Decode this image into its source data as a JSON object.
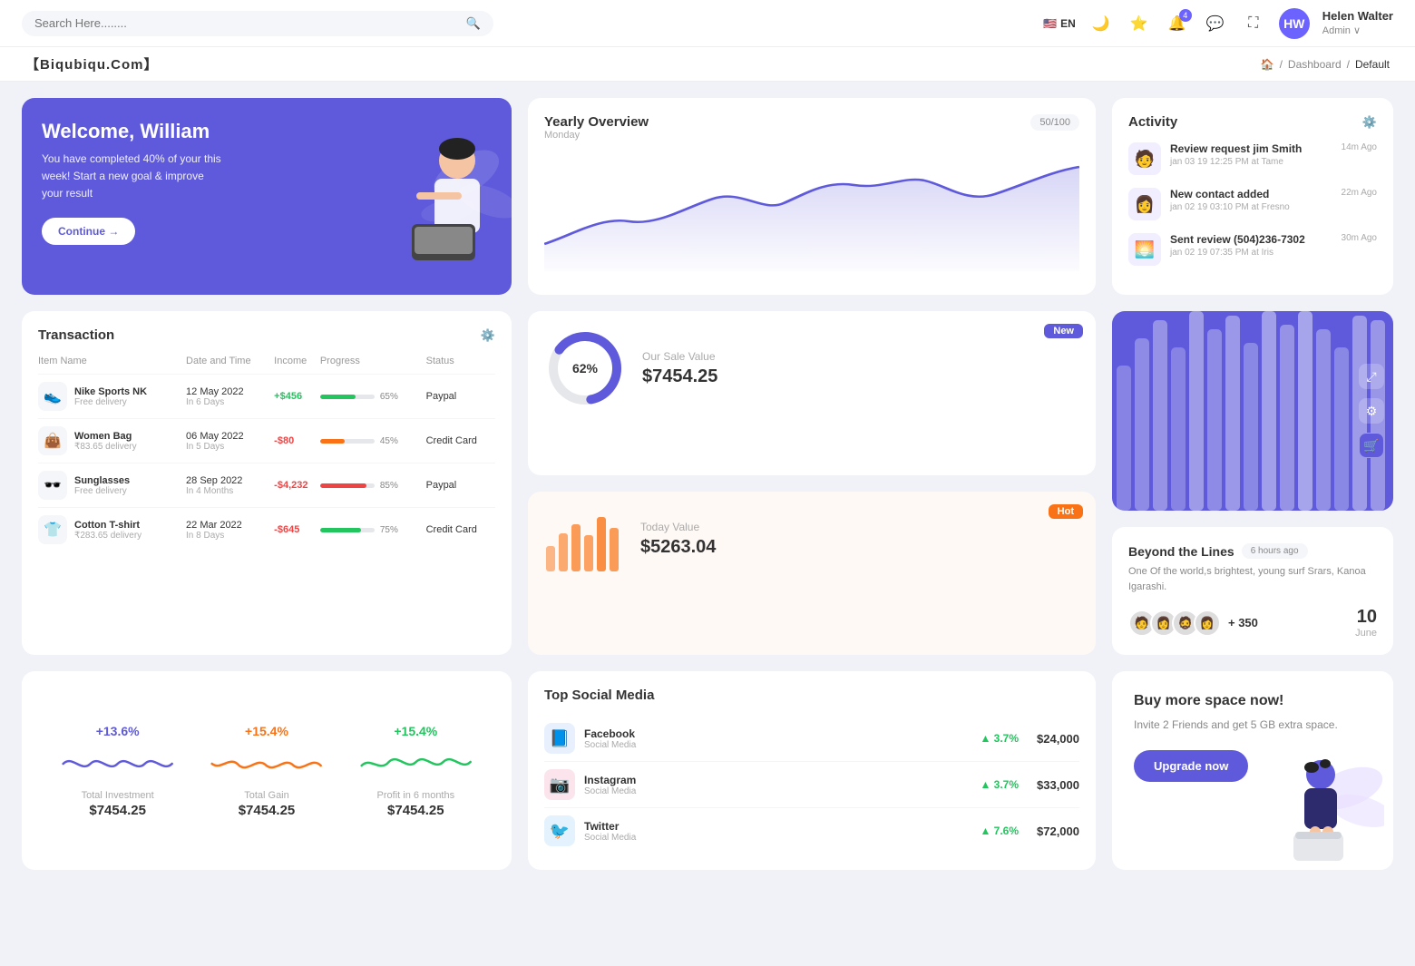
{
  "topnav": {
    "search_placeholder": "Search Here........",
    "lang": "EN",
    "notification_count": "4",
    "user": {
      "name": "Helen Walter",
      "role": "Admin ∨",
      "initials": "HW"
    }
  },
  "breadcrumb": {
    "brand": "【Biqubiqu.Com】",
    "home": "⌂",
    "dashboard": "Dashboard",
    "current": "Default"
  },
  "welcome": {
    "title": "Welcome, William",
    "subtitle": "You have completed 40% of your this week! Start a new goal & improve your result",
    "button": "Continue →"
  },
  "yearly_overview": {
    "title": "Yearly Overview",
    "day": "Monday",
    "progress": "50/100"
  },
  "activity": {
    "title": "Activity",
    "items": [
      {
        "title": "Review request jim Smith",
        "subtitle": "jan 03 19 12:25 PM at Tame",
        "time": "14m Ago",
        "emoji": "🧑"
      },
      {
        "title": "New contact added",
        "subtitle": "jan 02 19 03:10 PM at Fresno",
        "time": "22m Ago",
        "emoji": "👩"
      },
      {
        "title": "Sent review (504)236-7302",
        "subtitle": "jan 02 19 07:35 PM at Iris",
        "time": "30m Ago",
        "emoji": "🌅"
      }
    ]
  },
  "transaction": {
    "title": "Transaction",
    "columns": [
      "Item Name",
      "Date and Time",
      "Income",
      "Progress",
      "Status"
    ],
    "rows": [
      {
        "name": "Nike Sports NK",
        "sub": "Free delivery",
        "emoji": "👟",
        "date": "12 May 2022",
        "days": "In 6 Days",
        "income": "+$456",
        "income_type": "pos",
        "progress": 65,
        "progress_color": "#22c55e",
        "status": "Paypal"
      },
      {
        "name": "Women Bag",
        "sub": "₹83.65 delivery",
        "emoji": "👜",
        "date": "06 May 2022",
        "days": "In 5 Days",
        "income": "-$80",
        "income_type": "neg",
        "progress": 45,
        "progress_color": "#f97316",
        "status": "Credit Card"
      },
      {
        "name": "Sunglasses",
        "sub": "Free delivery",
        "emoji": "🕶️",
        "date": "28 Sep 2022",
        "days": "In 4 Months",
        "income": "-$4,232",
        "income_type": "neg",
        "progress": 85,
        "progress_color": "#ef4444",
        "status": "Paypal"
      },
      {
        "name": "Cotton T-shirt",
        "sub": "₹283.65 delivery",
        "emoji": "👕",
        "date": "22 Mar 2022",
        "days": "In 8 Days",
        "income": "-$645",
        "income_type": "neg",
        "progress": 75,
        "progress_color": "#22c55e",
        "status": "Credit Card"
      }
    ]
  },
  "sale_new": {
    "badge": "New",
    "label": "Our Sale Value",
    "value": "$7454.25",
    "donut_pct": "62%",
    "donut_value": 62
  },
  "sale_hot": {
    "badge": "Hot",
    "label": "Today Value",
    "value": "$5263.04",
    "bars": [
      30,
      50,
      65,
      45,
      70,
      55
    ]
  },
  "bar_chart": {
    "bars": [
      40,
      60,
      75,
      55,
      90,
      70,
      85,
      65,
      95,
      80,
      100,
      75,
      60,
      85,
      70,
      90
    ]
  },
  "beyond": {
    "title": "Beyond the Lines",
    "time": "6 hours ago",
    "desc": "One Of the world,s brightest, young surf Srars, Kanoa Igarashi.",
    "avatars": [
      "🧑",
      "👩",
      "🧔",
      "👩"
    ],
    "plus": "+ 350",
    "date_num": "10",
    "date_label": "June"
  },
  "stats": [
    {
      "pct": "+13.6%",
      "color": "blue",
      "label": "Total Investment",
      "value": "$7454.25"
    },
    {
      "pct": "+15.4%",
      "color": "orange",
      "label": "Total Gain",
      "value": "$7454.25"
    },
    {
      "pct": "+15.4%",
      "color": "green",
      "label": "Profit in 6 months",
      "value": "$7454.25"
    }
  ],
  "social": {
    "title": "Top Social Media",
    "items": [
      {
        "name": "Facebook",
        "sub": "Social Media",
        "pct": "3.7%",
        "amount": "$24,000",
        "emoji": "📘"
      },
      {
        "name": "Instagram",
        "sub": "Social Media",
        "pct": "3.7%",
        "amount": "$33,000",
        "emoji": "📷"
      },
      {
        "name": "Twitter",
        "sub": "Social Media",
        "pct": "7.6%",
        "amount": "$72,000",
        "emoji": "🐦"
      }
    ]
  },
  "buy_space": {
    "title": "Buy more space now!",
    "desc": "Invite 2 Friends and get 5 GB extra space.",
    "button": "Upgrade now"
  }
}
